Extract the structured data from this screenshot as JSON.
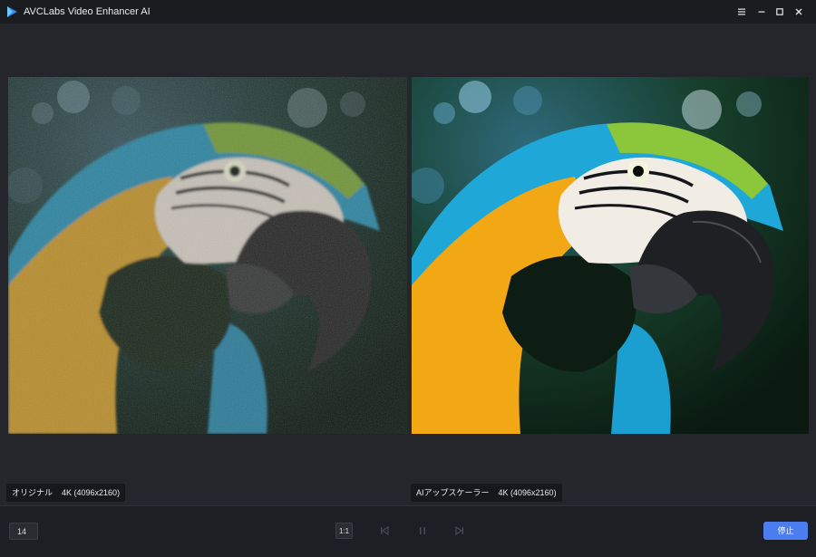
{
  "window": {
    "title": "AVCLabs Video Enhancer AI",
    "controls": [
      "menu-icon",
      "minimize-icon",
      "maximize-icon",
      "close-icon"
    ]
  },
  "preview": {
    "left": {
      "label": "オリジナル",
      "resolution": "4K (4096x2160)"
    },
    "right": {
      "label": "AIアップスケーラー",
      "resolution": "4K (4096x2160)"
    }
  },
  "controls": {
    "frame_number": "14",
    "zoom_label": "1:1",
    "stop_label": "停止",
    "icons": [
      "skip-back-icon",
      "pause-icon",
      "skip-forward-icon"
    ]
  },
  "colors": {
    "accent": "#4b7cf0",
    "titlebar": "#1b1c20",
    "background": "#23252b"
  }
}
